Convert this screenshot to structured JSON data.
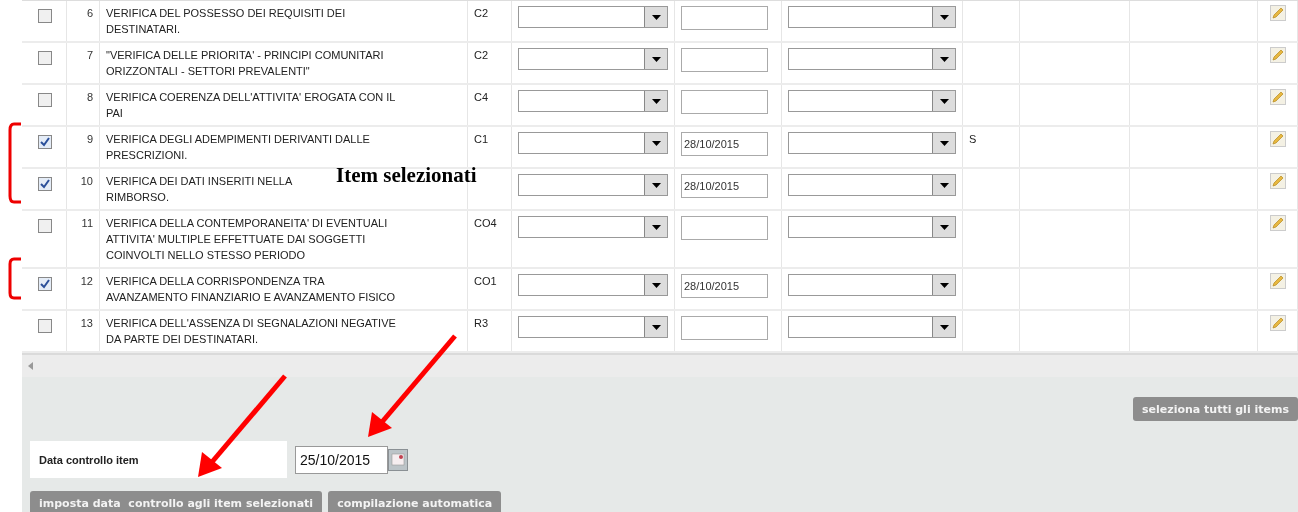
{
  "rows": [
    {
      "number": "6",
      "lines": [
        "VERIFICA DEL POSSESSO DEI REQUISITI DEI",
        "DESTINATARI."
      ],
      "code": "C2",
      "checked": false,
      "date": "",
      "flag": ""
    },
    {
      "number": "7",
      "lines": [
        "\"VERIFICA DELLE PRIORITA' - PRINCIPI COMUNITARI",
        "ORIZZONTALI - SETTORI PREVALENTI\""
      ],
      "code": "C2",
      "checked": false,
      "date": "",
      "flag": ""
    },
    {
      "number": "8",
      "lines": [
        "VERIFICA COERENZA DELL'ATTIVITA' EROGATA CON IL",
        "PAI"
      ],
      "code": "C4",
      "checked": false,
      "date": "",
      "flag": ""
    },
    {
      "number": "9",
      "lines": [
        "VERIFICA DEGLI ADEMPIMENTI DERIVANTI DALLE",
        "PRESCRIZIONI."
      ],
      "code": "C1",
      "checked": true,
      "date": "28/10/2015",
      "flag": "S"
    },
    {
      "number": "10",
      "lines": [
        "VERIFICA DEI DATI INSERITI NELLA",
        "RIMBORSO."
      ],
      "code": "",
      "checked": true,
      "date": "28/10/2015",
      "flag": ""
    },
    {
      "number": "11",
      "lines": [
        "VERIFICA DELLA CONTEMPORANEITA' DI EVENTUALI",
        "ATTIVITA' MULTIPLE EFFETTUATE DAI SOGGETTI",
        "COINVOLTI NELLO STESSO PERIODO"
      ],
      "code": "CO4",
      "checked": false,
      "date": "",
      "flag": ""
    },
    {
      "number": "12",
      "lines": [
        "VERIFICA DELLA CORRISPONDENZA TRA",
        "AVANZAMENTO FINANZIARIO E AVANZAMENTO FISICO"
      ],
      "code": "CO1",
      "checked": true,
      "date": "28/10/2015",
      "flag": ""
    },
    {
      "number": "13",
      "lines": [
        "VERIFICA DELL'ASSENZA DI SEGNALAZIONI NEGATIVE",
        "DA PARTE DEI DESTINATARI."
      ],
      "code": "R3",
      "checked": false,
      "date": "",
      "flag": ""
    }
  ],
  "select_all_button": "seleziona tutti gli items",
  "date_control": {
    "label": "Data controllo item",
    "value": "25/10/2015"
  },
  "buttons": [
    "imposta data  controllo agli item selezionati",
    "compilazione automatica"
  ],
  "annotation": {
    "label": "Item selezionati"
  }
}
